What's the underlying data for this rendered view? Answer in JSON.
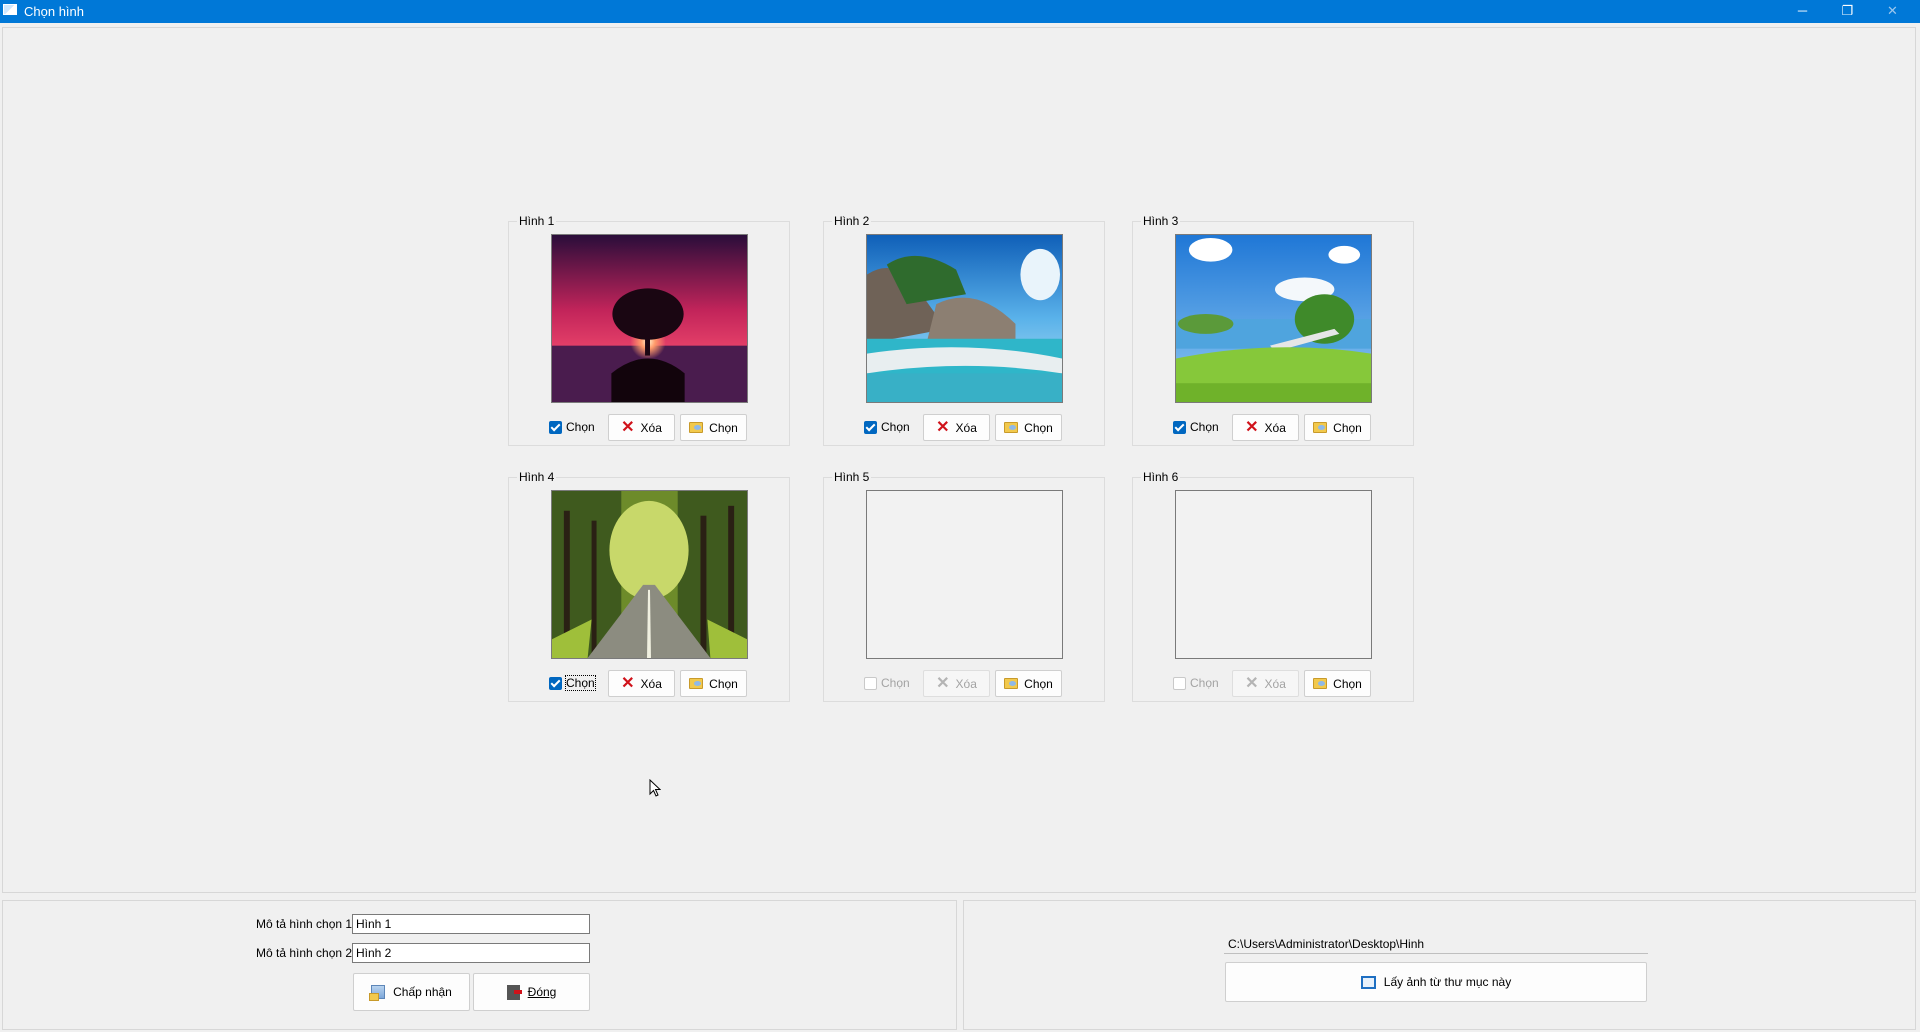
{
  "window": {
    "title": "Chọn hình",
    "minimize_glyph": "─",
    "maximize_glyph": "❐",
    "close_glyph": "✕"
  },
  "image_groups": [
    {
      "legend": "Hình 1",
      "image": "sunset-tree-photo",
      "checked": true,
      "check_label": "Chọn",
      "delete_label": "Xóa",
      "pick_label": "Chọn",
      "enabled": true
    },
    {
      "legend": "Hình 2",
      "image": "tropical-beach-photo",
      "checked": true,
      "check_label": "Chọn",
      "delete_label": "Xóa",
      "pick_label": "Chọn",
      "enabled": true
    },
    {
      "legend": "Hình 3",
      "image": "green-meadow-lake-photo",
      "checked": true,
      "check_label": "Chọn",
      "delete_label": "Xóa",
      "pick_label": "Chọn",
      "enabled": true
    },
    {
      "legend": "Hình 4",
      "image": "tree-lined-road-photo",
      "checked": true,
      "check_label": "Chọn",
      "delete_label": "Xóa",
      "pick_label": "Chọn",
      "enabled": true
    },
    {
      "legend": "Hình 5",
      "image": "",
      "checked": false,
      "check_label": "Chọn",
      "delete_label": "Xóa",
      "pick_label": "Chọn",
      "enabled": false
    },
    {
      "legend": "Hình 6",
      "image": "",
      "checked": false,
      "check_label": "Chọn",
      "delete_label": "Xóa",
      "pick_label": "Chọn",
      "enabled": false
    }
  ],
  "description": {
    "label_1": "Mô tả hình chọn 1:",
    "value_1": "Hình 1",
    "label_2": "Mô tả hình chọn 2:",
    "value_2": "Hình 2"
  },
  "actions": {
    "accept_label": "Chấp nhận",
    "close_label": "Đóng"
  },
  "folder": {
    "path": "C:\\Users\\Administrator\\Desktop\\Hinh",
    "load_label": "Lấy ảnh từ thư mục này"
  },
  "colors": {
    "titlebar": "#0078d7",
    "checkbox": "#0067c0",
    "delete_icon": "#d0121a"
  }
}
